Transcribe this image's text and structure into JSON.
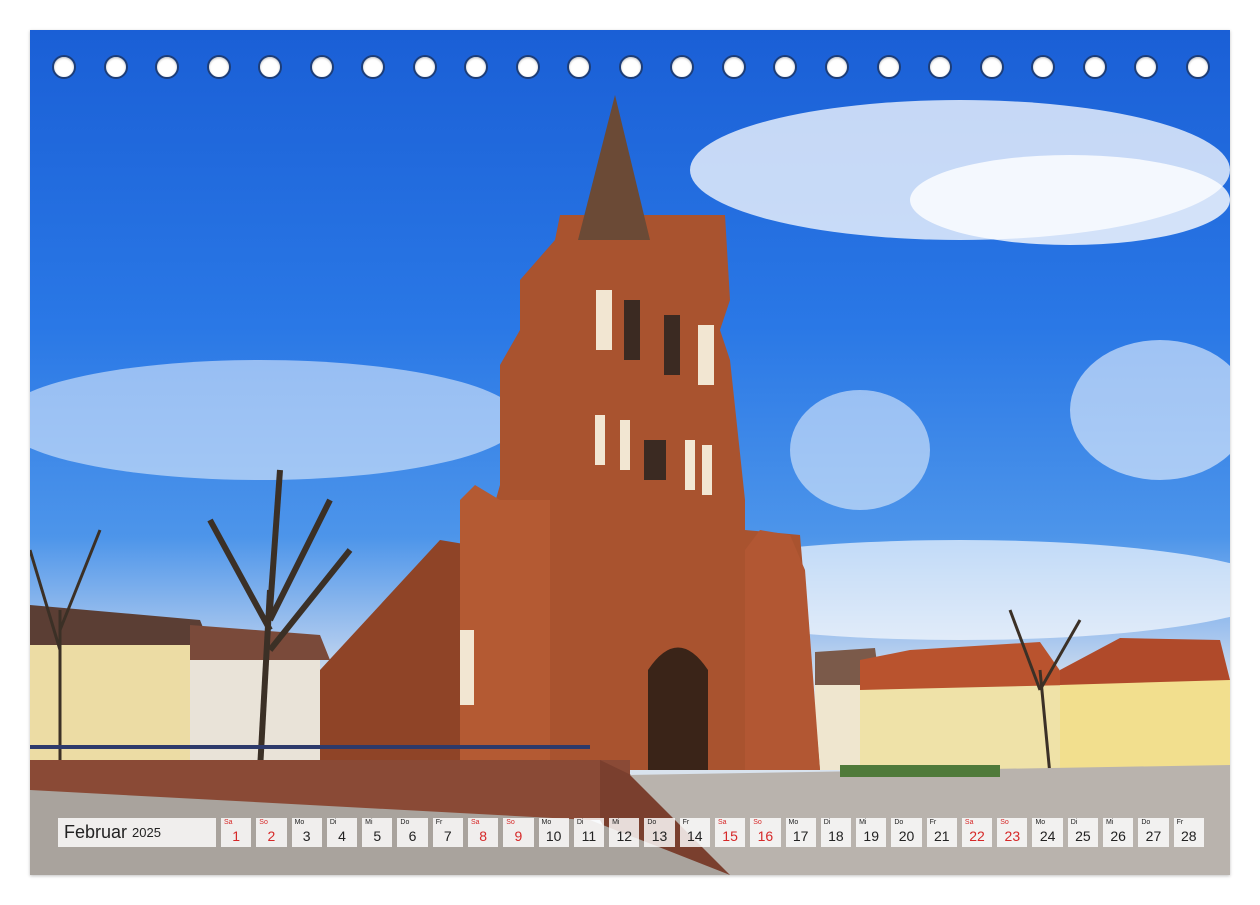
{
  "calendar": {
    "month": "Februar",
    "year": "2025",
    "days": [
      {
        "wd": "Sa",
        "num": "1",
        "weekend": true
      },
      {
        "wd": "So",
        "num": "2",
        "weekend": true
      },
      {
        "wd": "Mo",
        "num": "3",
        "weekend": false
      },
      {
        "wd": "Di",
        "num": "4",
        "weekend": false
      },
      {
        "wd": "Mi",
        "num": "5",
        "weekend": false
      },
      {
        "wd": "Do",
        "num": "6",
        "weekend": false
      },
      {
        "wd": "Fr",
        "num": "7",
        "weekend": false
      },
      {
        "wd": "Sa",
        "num": "8",
        "weekend": true
      },
      {
        "wd": "So",
        "num": "9",
        "weekend": true
      },
      {
        "wd": "Mo",
        "num": "10",
        "weekend": false
      },
      {
        "wd": "Di",
        "num": "11",
        "weekend": false
      },
      {
        "wd": "Mi",
        "num": "12",
        "weekend": false
      },
      {
        "wd": "Do",
        "num": "13",
        "weekend": false
      },
      {
        "wd": "Fr",
        "num": "14",
        "weekend": false
      },
      {
        "wd": "Sa",
        "num": "15",
        "weekend": true
      },
      {
        "wd": "So",
        "num": "16",
        "weekend": true
      },
      {
        "wd": "Mo",
        "num": "17",
        "weekend": false
      },
      {
        "wd": "Di",
        "num": "18",
        "weekend": false
      },
      {
        "wd": "Mi",
        "num": "19",
        "weekend": false
      },
      {
        "wd": "Do",
        "num": "20",
        "weekend": false
      },
      {
        "wd": "Fr",
        "num": "21",
        "weekend": false
      },
      {
        "wd": "Sa",
        "num": "22",
        "weekend": true
      },
      {
        "wd": "So",
        "num": "23",
        "weekend": true
      },
      {
        "wd": "Mo",
        "num": "24",
        "weekend": false
      },
      {
        "wd": "Di",
        "num": "25",
        "weekend": false
      },
      {
        "wd": "Mi",
        "num": "26",
        "weekend": false
      },
      {
        "wd": "Do",
        "num": "27",
        "weekend": false
      },
      {
        "wd": "Fr",
        "num": "28",
        "weekend": false
      }
    ]
  },
  "colors": {
    "weekend": "#d62828",
    "sky": "#2a78e6",
    "brick": "#a9532f"
  }
}
